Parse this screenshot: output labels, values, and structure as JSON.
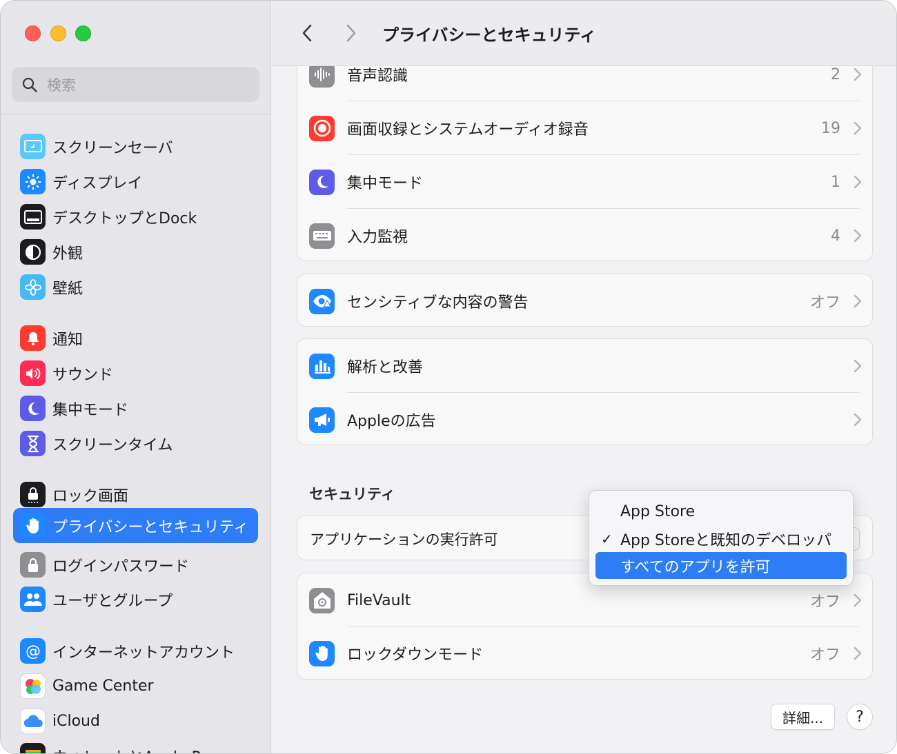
{
  "window": {
    "title": "プライバシーとセキュリティ"
  },
  "sidebar": {
    "search_placeholder": "検索",
    "items": [
      {
        "label": "スクリーンセーバ",
        "icon": "screensaver-icon",
        "color": "#5ac8fa"
      },
      {
        "label": "ディスプレイ",
        "icon": "display-icon",
        "color": "#1e88ff"
      },
      {
        "label": "デスクトップとDock",
        "icon": "dock-icon",
        "color": "#1c1c1e"
      },
      {
        "label": "外観",
        "icon": "appearance-icon",
        "color": "#1c1c1e"
      },
      {
        "label": "壁紙",
        "icon": "wallpaper-icon",
        "color": "#45b8f5"
      },
      {
        "label": "通知",
        "icon": "bell-icon",
        "color": "#ff3b30"
      },
      {
        "label": "サウンド",
        "icon": "speaker-icon",
        "color": "#ff2d55"
      },
      {
        "label": "集中モード",
        "icon": "moon-icon",
        "color": "#5e5ce6"
      },
      {
        "label": "スクリーンタイム",
        "icon": "hourglass-icon",
        "color": "#5e5ce6"
      },
      {
        "label": "ロック画面",
        "icon": "lock-screen-icon",
        "color": "#1c1c1e"
      },
      {
        "label": "プライバシーとセキュリティ",
        "icon": "hand-icon",
        "color": "#1e88ff"
      },
      {
        "label": "ログインパスワード",
        "icon": "lock-icon",
        "color": "#8e8e93"
      },
      {
        "label": "ユーザとグループ",
        "icon": "users-icon",
        "color": "#1e88ff"
      },
      {
        "label": "インターネットアカウント",
        "icon": "at-icon",
        "color": "#1e88ff"
      },
      {
        "label": "Game Center",
        "icon": "game-center-icon",
        "color": "#ffffff"
      },
      {
        "label": "iCloud",
        "icon": "cloud-icon",
        "color": "#ffffff"
      },
      {
        "label": "ウォレットとApple Pay",
        "icon": "wallet-icon",
        "color": "#1c1c1e"
      }
    ],
    "selected": "プライバシーとセキュリティ"
  },
  "privacy_group_1": [
    {
      "label": "音声認識",
      "value": "2",
      "icon": "waveform-icon",
      "color": "#8e8e93"
    },
    {
      "label": "画面収録とシステムオーディオ録音",
      "value": "19",
      "icon": "record-icon",
      "color": "#ff3b30"
    },
    {
      "label": "集中モード",
      "value": "1",
      "icon": "moon-icon",
      "color": "#5e5ce6"
    },
    {
      "label": "入力監視",
      "value": "4",
      "icon": "keyboard-icon",
      "color": "#8e8e93"
    }
  ],
  "privacy_group_2": [
    {
      "label": "センシティブな内容の警告",
      "value": "オフ",
      "icon": "eye-warning-icon",
      "color": "#1e88ff"
    }
  ],
  "privacy_group_3": [
    {
      "label": "解析と改善",
      "value": "",
      "icon": "chart-icon",
      "color": "#1e88ff"
    },
    {
      "label": "Appleの広告",
      "value": "",
      "icon": "megaphone-icon",
      "color": "#1e88ff"
    }
  ],
  "security": {
    "title": "セキュリティ",
    "app_permission_label": "アプリケーションの実行許可",
    "rows": [
      {
        "label": "FileVault",
        "value": "オフ",
        "icon": "filevault-icon",
        "color": "#8e8e93"
      },
      {
        "label": "ロックダウンモード",
        "value": "オフ",
        "icon": "hand-icon",
        "color": "#1e88ff"
      }
    ]
  },
  "dropdown": {
    "options": [
      {
        "label": "App Store",
        "checked": false,
        "highlighted": false
      },
      {
        "label": "App Storeと既知のデベロッパ",
        "checked": true,
        "highlighted": false
      },
      {
        "label": "すべてのアプリを許可",
        "checked": false,
        "highlighted": true
      }
    ],
    "checkmark": "✓"
  },
  "footer": {
    "detail_button": "詳細...",
    "help_button": "?"
  },
  "colors": {
    "accent": "#2e7cf6"
  }
}
